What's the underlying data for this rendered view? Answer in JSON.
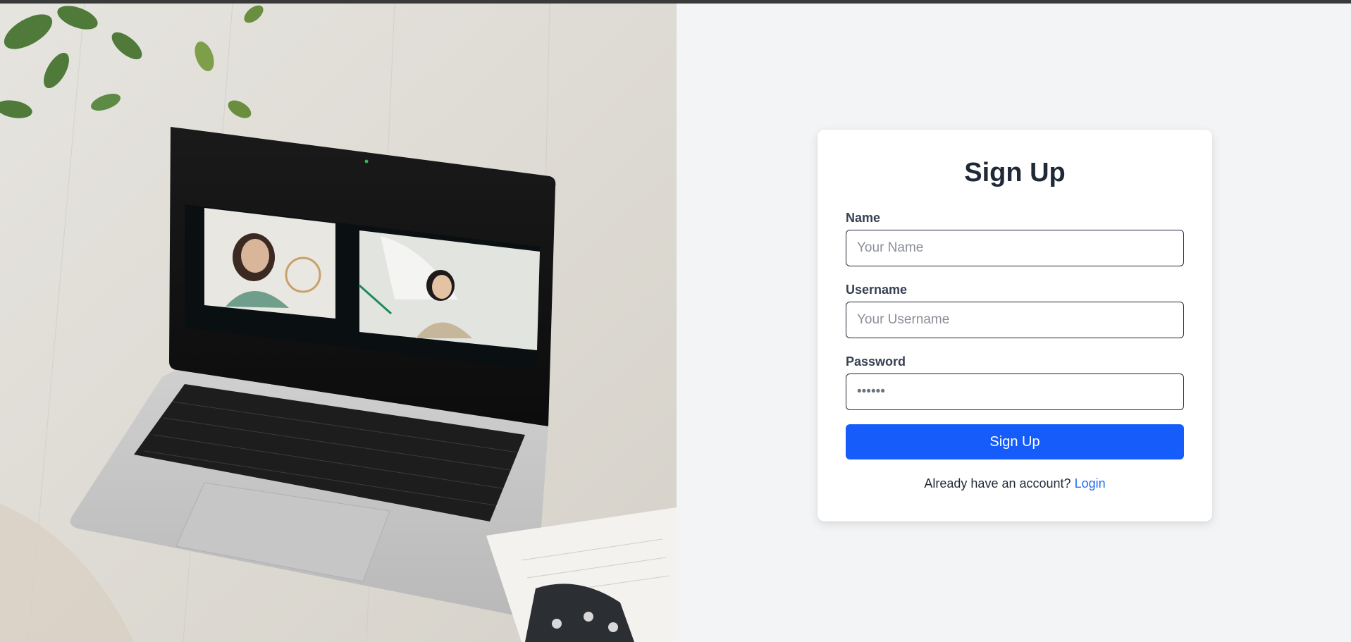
{
  "form": {
    "title": "Sign Up",
    "fields": [
      {
        "label": "Name",
        "placeholder": "Your Name",
        "value": ""
      },
      {
        "label": "Username",
        "placeholder": "Your Username",
        "value": ""
      },
      {
        "label": "Password",
        "placeholder": "",
        "value": "••••••"
      }
    ],
    "submit_label": "Sign Up",
    "footer_text": "Already have an account?",
    "footer_link": "Login"
  },
  "colors": {
    "background": "#f3f4f6",
    "primary": "#155cfb",
    "link": "#1d6ef3",
    "heading": "#1f2937"
  },
  "hero": {
    "image": "laptop-video-call-photo"
  }
}
